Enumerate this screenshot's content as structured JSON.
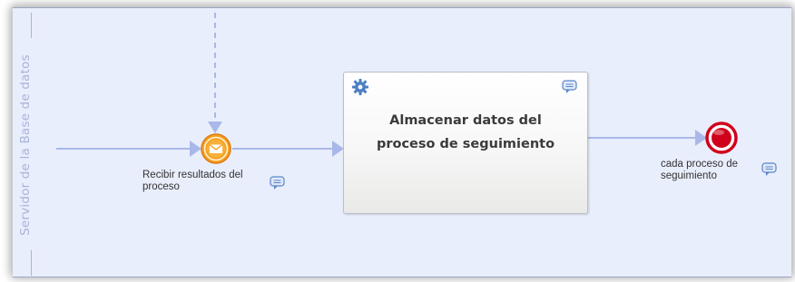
{
  "lane": {
    "label": "Servidor de la Base de datos"
  },
  "task": {
    "line1": "Almacenar datos del",
    "line2": "proceso de seguimiento",
    "type_icon": "gear-icon"
  },
  "start_event": {
    "type": "message-intermediate-event",
    "line1": "Recibir resultados del",
    "line2": "proceso"
  },
  "end_event": {
    "type": "end-event",
    "line1": "cada proceso de",
    "line2": "seguimiento"
  },
  "colors": {
    "lane_bg": "#e9eefc",
    "flow": "#a9b8e9",
    "message_event": "#f5a020",
    "end_event": "#d0021b"
  }
}
